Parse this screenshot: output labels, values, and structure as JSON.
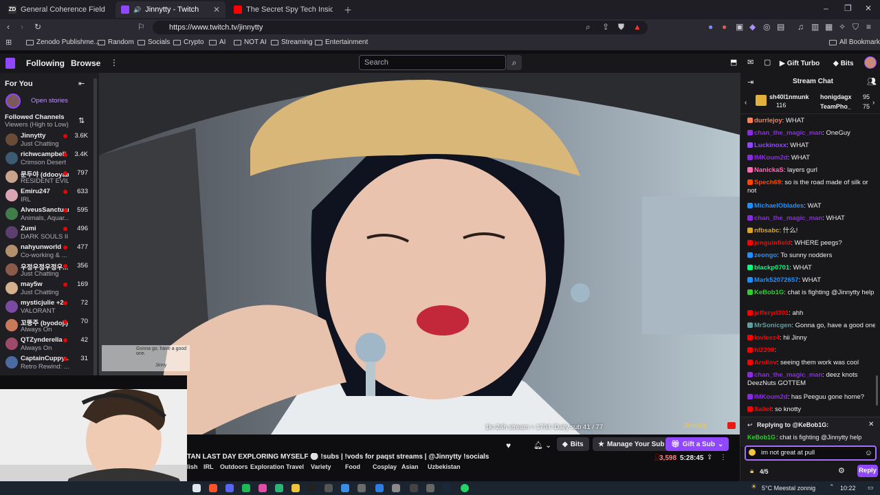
{
  "browser": {
    "tabs": [
      {
        "title": "General Coherence Field Theory (GC",
        "favicon": "ZD"
      },
      {
        "title": "Jinnytty - Twitch",
        "favicon": "twitch"
      },
      {
        "title": "The Secret Spy Tech Inside Every Cre",
        "favicon": "youtube"
      }
    ],
    "url": "https://www.twitch.tv/jinnytty",
    "bookmarks": [
      "Zenodo Publishme...",
      "Random",
      "Socials",
      "Crypto",
      "AI",
      "NOT AI",
      "Streaming",
      "Entertainment"
    ],
    "all_bookmarks": "All Bookmarks"
  },
  "twitch_nav": {
    "following": "Following",
    "browse": "Browse",
    "search_placeholder": "Search",
    "gift_turbo": "Gift Turbo",
    "bits": "Bits"
  },
  "sidebar": {
    "for_you": "For You",
    "open_stories": "Open stories",
    "followed_title": "Followed Channels",
    "followed_sort": "Viewers (High to Low)",
    "channels": [
      {
        "name": "Jinnytty",
        "game": "Just Chatting",
        "viewers": "3.6K",
        "color": "#6a4b3a"
      },
      {
        "name": "richwcampbell",
        "game": "Crimson Desert",
        "viewers": "3.4K",
        "color": "#3d5a73"
      },
      {
        "name": "문두야 (ddooyaa)",
        "game": "RESIDENT EVIL...",
        "viewers": "797",
        "color": "#caa38c"
      },
      {
        "name": "Emiru247",
        "game": "IRL",
        "viewers": "633",
        "color": "#d9a5b3"
      },
      {
        "name": "AlveusSanctuary",
        "game": "Animals, Aquar...",
        "viewers": "595",
        "color": "#3f7d4a"
      },
      {
        "name": "Zumi",
        "game": "DARK SOULS III",
        "viewers": "496",
        "color": "#5b3f6e"
      },
      {
        "name": "nahyunworld",
        "game": "Co-working & ...",
        "viewers": "477",
        "color": "#b3906d"
      },
      {
        "name": "우정우정우정우...",
        "game": "Just Chatting",
        "viewers": "356",
        "color": "#8a5a4a"
      },
      {
        "name": "may5w",
        "game": "Just Chatting",
        "viewers": "169",
        "color": "#d4b08c"
      },
      {
        "name": "mysticjulie +2",
        "game": "VALORANT",
        "viewers": "72",
        "color": "#7a4aa0"
      },
      {
        "name": "꼬뚱주 (byodoji)",
        "game": "Always On",
        "viewers": "70",
        "color": "#c9785a"
      },
      {
        "name": "QTZynderella",
        "game": "Always On",
        "viewers": "42",
        "color": "#a04a6a"
      },
      {
        "name": "CaptainCuppy...",
        "game": "Retro Rewind: ...",
        "viewers": "31",
        "color": "#4a6aa0"
      }
    ]
  },
  "video": {
    "overlay_counter": "1k=24h stream = 1704  !Daily sub 41 / 77",
    "overlay_chat_1": "Gonna go, have a good one.",
    "overlay_chat_2": "Jinny",
    "watermark": "Jinnytty"
  },
  "stream_info": {
    "title": "TAN LAST DAY EXPLORING MYSELF ⚪ !subs | !vods for paqst streams | @Jinnytty !socials",
    "viewers": "3,598",
    "uptime": "5:28:45",
    "tags": [
      "lish",
      "IRL",
      "Outdoors",
      "Exploration",
      "Travel",
      "Variety",
      "Food",
      "Cosplay",
      "Asian",
      "Uzbekistan"
    ],
    "bits": "Bits",
    "manage_sub": "Manage Your Sub",
    "gift_sub": "Gift a Sub"
  },
  "chat": {
    "header": "Stream Chat",
    "leaderboard": [
      {
        "name": "sh40l1nmunk",
        "count": "116"
      },
      {
        "name": "honigdagx",
        "count": "95"
      },
      {
        "name": "TeamPho_",
        "count": "75"
      }
    ],
    "messages": [
      {
        "user": "durrlejoy",
        "text": ": WHAT",
        "color": "#ff7f50"
      },
      {
        "user": "chan_the_magic_man",
        "text": ": OneGuy",
        "color": "#8a2be2"
      },
      {
        "user": "Luckinoxx",
        "text": ": WHAT",
        "color": "#9146ff"
      },
      {
        "user": "IMKoum2d",
        "text": ": WHAT",
        "color": "#8a2be2"
      },
      {
        "user": "NanickaS",
        "text": ": layers gurl",
        "color": "#ff69b4"
      },
      {
        "user": "Spech69",
        "text": ": so is the road made of silk or not",
        "color": "#ff4500"
      },
      {
        "user": "MichaelOblades",
        "text": ": WAT",
        "color": "#1e90ff"
      },
      {
        "user": "chan_the_magic_man",
        "text": ": WHAT",
        "color": "#8a2be2"
      },
      {
        "user": "nfbsabc",
        "text": ": 什么!",
        "color": "#daa520"
      },
      {
        "user": "jenguinfield",
        "text": ": WHERE peegs?",
        "color": "#ff0000"
      },
      {
        "user": "zeongo",
        "text": ": To sunny nodders",
        "color": "#1e90ff"
      },
      {
        "user": "blackp0701",
        "text": ": WHAT",
        "color": "#00ff7f"
      },
      {
        "user": "Mark52072657",
        "text": ": WHAT",
        "color": "#1e90ff"
      },
      {
        "user": "KeBob1G",
        "text": ": chat is fighting @Jinnytty help",
        "color": "#32cd32"
      },
      {
        "user": "jefferyd301",
        "text": ": ahh",
        "color": "#ff0000"
      },
      {
        "user": "MrSonicgen",
        "text": ": Gonna go, have a good one.",
        "color": "#5f9ea0"
      },
      {
        "user": "lovleez4",
        "text": ": hii Jinny",
        "color": "#ff0000"
      },
      {
        "user": "hl2299",
        "text": ":",
        "color": "#ff0000"
      },
      {
        "user": "Arollov",
        "text": ": seeing them work was cool",
        "color": "#ff0000"
      },
      {
        "user": "chan_the_magic_man",
        "text": ": deez knots DeezNuts GOTTEM",
        "color": "#8a2be2"
      },
      {
        "user": "IMKoum2d",
        "text": ": has Peeguu gone home?",
        "color": "#8a2be2"
      },
      {
        "user": "Saliel",
        "text": ": so knotty",
        "color": "#ff0000"
      }
    ],
    "reply_to": "Replying to @KeBob1G:",
    "reply_user": "KeBob1G",
    "reply_text": ": chat is fighting @Jinnytty help",
    "input_value": "im not great at pull",
    "bits_count": "4/5",
    "reply_button": "Reply"
  },
  "taskbar": {
    "weather": "5°C  Meestal zonnig",
    "time": "10:22"
  }
}
